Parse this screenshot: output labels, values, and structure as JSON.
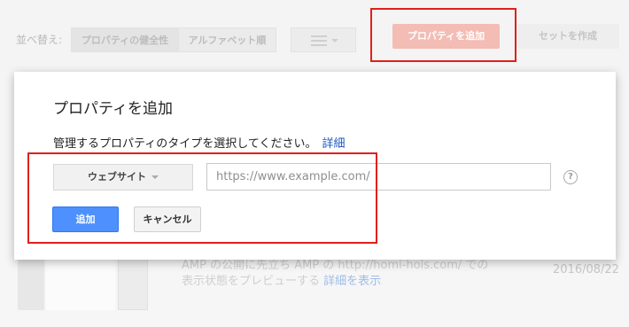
{
  "toolbar": {
    "sort_label": "並べ替え:",
    "sort_options": [
      "プロパティの健全性",
      "アルファベット順"
    ],
    "add_property_label": "プロパティを追加",
    "create_set_label": "セットを作成"
  },
  "dialog": {
    "title": "プロパティを追加",
    "prompt": "管理するプロパティのタイプを選択してください。",
    "details_link": "詳細",
    "property_type": "ウェブサイト",
    "url_placeholder": "https://www.example.com/",
    "help_symbol": "?",
    "add_button": "追加",
    "cancel_button": "キャンセル"
  },
  "background_property": {
    "description_line1": "AMP の公開に先立ち AMP の http://homi-hois.com/ での",
    "description_line2": "表示状態をプレビューする",
    "show_details_link": "詳細を表示",
    "date": "2016/08/22"
  },
  "colors": {
    "accent_blue": "#4d90fe",
    "link_blue": "#1a57c4",
    "highlight_red": "#e0201a",
    "add_property_button": "#f3bcb4"
  }
}
